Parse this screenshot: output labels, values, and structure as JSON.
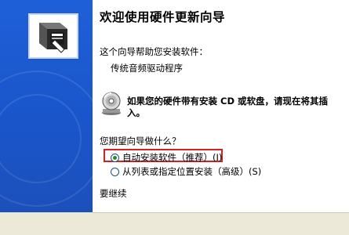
{
  "wizard": {
    "title": "欢迎使用硬件更新向导",
    "intro": "这个向导帮助您安装软件：",
    "device_name": "传统音频驱动程序",
    "cd_prompt": "如果您的硬件带有安装 CD 或软盘，请现在将其插入。",
    "question": "您期望向导做什么？",
    "options": [
      {
        "label": "自动安装软件（推荐）",
        "shortcut": "(I)",
        "selected": true
      },
      {
        "label": "从列表或指定位置安装（高级）",
        "shortcut": "(S)",
        "selected": false
      }
    ],
    "continue_hint": "要继续"
  },
  "colors": {
    "sidebar_blue": "#1e5fd8",
    "highlight_red": "#d42020",
    "radio_green": "#2d8a1e"
  },
  "icons": {
    "wizard": "hardware-wizard-icon",
    "cd": "cd-disc-icon"
  }
}
